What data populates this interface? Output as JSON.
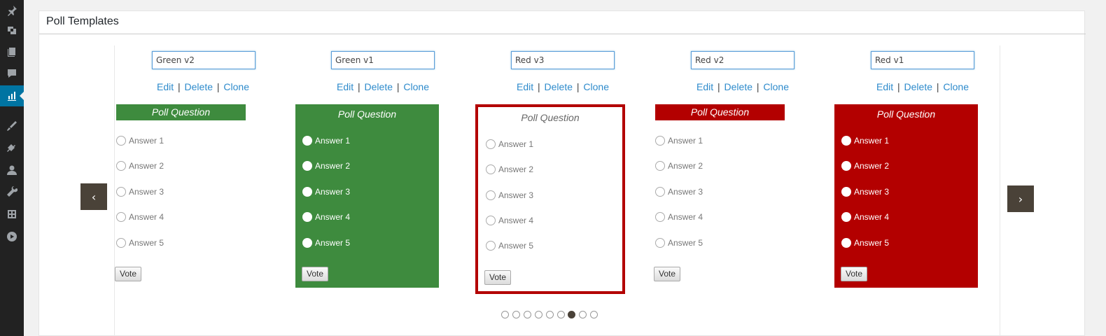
{
  "sidebar": {
    "icons": [
      "pin-icon",
      "media-icon",
      "pages-icon",
      "comments-icon",
      "poll-chart-icon",
      "appearance-icon",
      "plugins-icon",
      "users-icon",
      "tools-icon",
      "settings-icon",
      "play-icon"
    ],
    "active_index": 4
  },
  "panel": {
    "title": "Poll Templates"
  },
  "carousel": {
    "prev_label": "‹",
    "next_label": "›",
    "dots_total": 9,
    "active_dot": 6
  },
  "actions": {
    "edit": "Edit",
    "delete": "Delete",
    "clone": "Clone",
    "separator": "|"
  },
  "templates": [
    {
      "name": "Green v2",
      "question": "Poll Question",
      "answers": [
        "Answer 1",
        "Answer 2",
        "Answer 3",
        "Answer 4",
        "Answer 5"
      ],
      "vote": "Vote",
      "accent": "#3e8b3e"
    },
    {
      "name": "Green v1",
      "question": "Poll Question",
      "answers": [
        "Answer 1",
        "Answer 2",
        "Answer 3",
        "Answer 4",
        "Answer 5"
      ],
      "vote": "Vote",
      "accent": "#3e8b3e"
    },
    {
      "name": "Red v3",
      "question": "Poll Question",
      "answers": [
        "Answer 1",
        "Answer 2",
        "Answer 3",
        "Answer 4",
        "Answer 5"
      ],
      "vote": "Vote",
      "accent": "#b30000"
    },
    {
      "name": "Red v2",
      "question": "Poll Question",
      "answers": [
        "Answer 1",
        "Answer 2",
        "Answer 3",
        "Answer 4",
        "Answer 5"
      ],
      "vote": "Vote",
      "accent": "#b30000"
    },
    {
      "name": "Red v1",
      "question": "Poll Question",
      "answers": [
        "Answer 1",
        "Answer 2",
        "Answer 3",
        "Answer 4",
        "Answer 5"
      ],
      "vote": "Vote",
      "accent": "#b30000"
    }
  ]
}
